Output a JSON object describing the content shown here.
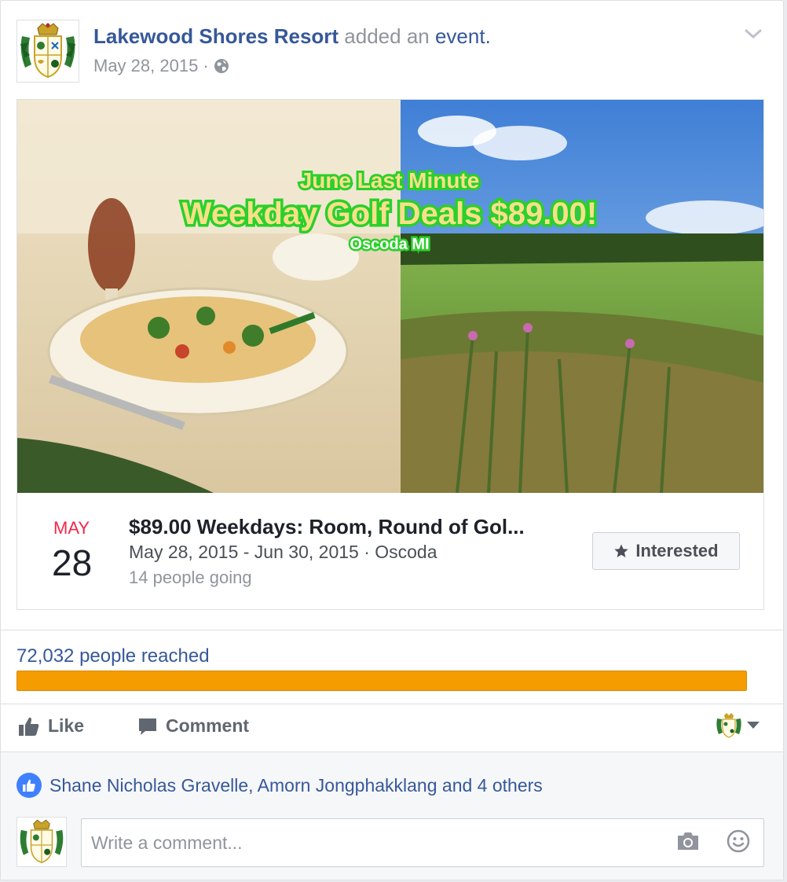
{
  "post": {
    "page_name": "Lakewood Shores Resort",
    "action_text": " added an ",
    "event_word": "event",
    "period": ".",
    "date": "May 28, 2015",
    "separator": "·",
    "audience_icon": "globe-icon",
    "menu_icon": "chevron-down-icon"
  },
  "cover": {
    "headline_line1": "June Last Minute",
    "headline_line2": "Weekday Golf Deals $89.00!",
    "headline_line3": "Oscoda MI"
  },
  "event": {
    "month": "MAY",
    "day": "28",
    "title": "$89.00 Weekdays: Room, Round of Gol...",
    "dates_location": "May 28, 2015 - Jun 30, 2015 · Oscoda",
    "going": "14 people going",
    "interested_label": "Interested",
    "interested_icon": "star-icon"
  },
  "reach": {
    "text": "72,032 people reached",
    "progress_fraction": 1.0,
    "bar_color": "#f59c00"
  },
  "actions": {
    "like_label": "Like",
    "comment_label": "Comment"
  },
  "likes": {
    "text": "Shane Nicholas Gravelle, Amorn Jongphakklang and 4 others"
  },
  "comment": {
    "placeholder": "Write a comment..."
  },
  "colors": {
    "link": "#365899",
    "muted": "#90949c",
    "accent_red": "#f02849",
    "like_blue": "#4080ff"
  }
}
